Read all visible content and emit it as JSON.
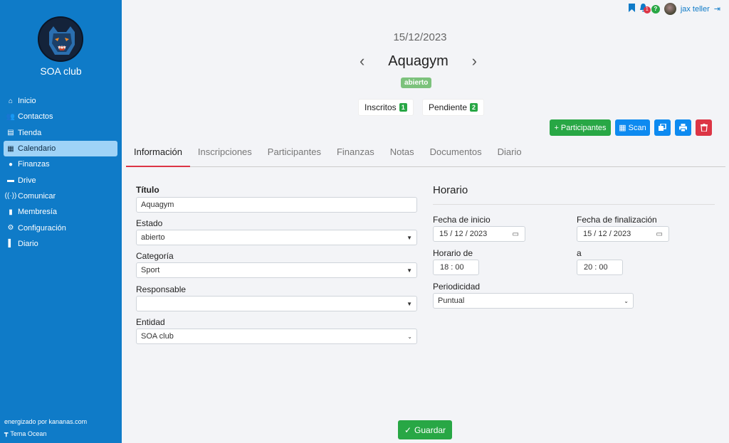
{
  "sidebar": {
    "club_name": "SOA club",
    "items": [
      {
        "label": "Inicio",
        "icon": "home-icon"
      },
      {
        "label": "Contactos",
        "icon": "users-icon"
      },
      {
        "label": "Tienda",
        "icon": "store-icon"
      },
      {
        "label": "Calendario",
        "icon": "calendar-icon"
      },
      {
        "label": "Finanzas",
        "icon": "piggy-icon"
      },
      {
        "label": "Drive",
        "icon": "drive-icon"
      },
      {
        "label": "Comunicar",
        "icon": "broadcast-icon"
      },
      {
        "label": "Membresía",
        "icon": "building-icon"
      },
      {
        "label": "Configuración",
        "icon": "gear-icon"
      },
      {
        "label": "Diario",
        "icon": "book-icon"
      }
    ],
    "active_index": 3,
    "footer_powered": "energizado por kananas.com",
    "footer_theme": "Tema Ocean"
  },
  "topbar": {
    "notifications_count": "1",
    "help": "?",
    "user_name": "jax teller"
  },
  "event": {
    "date": "15/12/2023",
    "title": "Aquagym",
    "status": "abierto",
    "inscritos_label": "Inscritos",
    "inscritos_count": "1",
    "pendiente_label": "Pendiente",
    "pendiente_count": "2"
  },
  "actions": {
    "participantes": "+ Participantes",
    "scan": "Scan"
  },
  "tabs": [
    "Información",
    "Inscripciones",
    "Participantes",
    "Finanzas",
    "Notas",
    "Documentos",
    "Diario"
  ],
  "form": {
    "titulo_label": "Título",
    "titulo_value": "Aquagym",
    "estado_label": "Estado",
    "estado_value": "abierto",
    "categoria_label": "Categoría",
    "categoria_value": "Sport",
    "responsable_label": "Responsable",
    "responsable_value": "",
    "entidad_label": "Entidad",
    "entidad_value": "SOA club"
  },
  "horario": {
    "title": "Horario",
    "fecha_inicio_label": "Fecha de inicio",
    "fecha_inicio_value": "15 / 12 / 2023",
    "fecha_fin_label": "Fecha de finalización",
    "fecha_fin_value": "15 / 12 / 2023",
    "horario_de_label": "Horario de",
    "horario_de_value": "18 : 00",
    "a_label": "a",
    "a_value": "20 : 00",
    "periodicidad_label": "Periodicidad",
    "periodicidad_value": "Puntual"
  },
  "save_label": "Guardar",
  "colors": {
    "sidebar": "#0f7bc8",
    "active_item": "#9fd3f7",
    "green": "#28a745",
    "red": "#dc3545",
    "blue": "#0d8af0"
  }
}
